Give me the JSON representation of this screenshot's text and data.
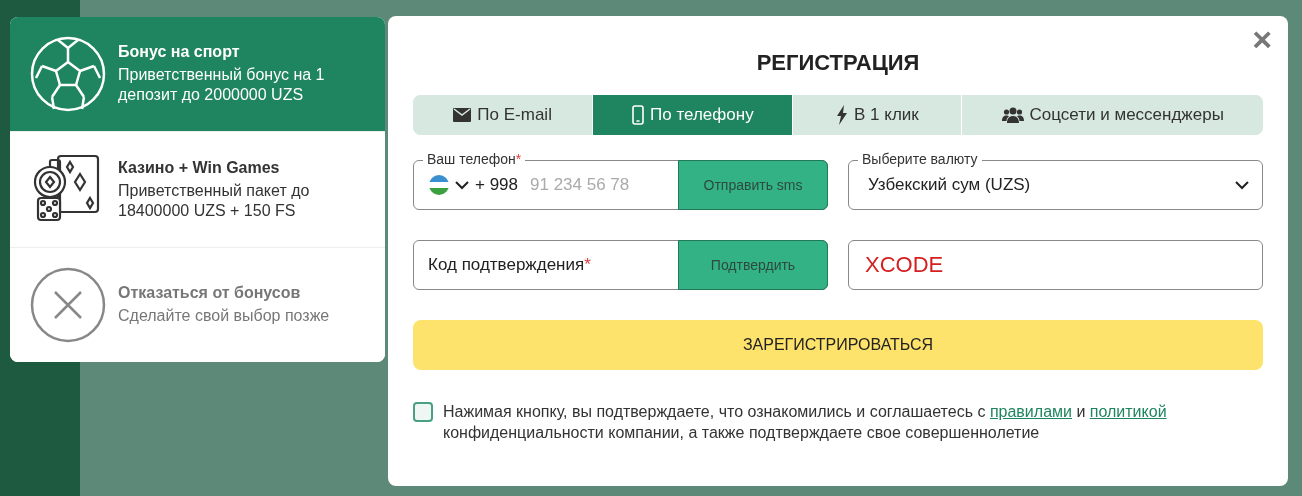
{
  "bonuses": [
    {
      "kind": "sport",
      "title": "Бонус на спорт",
      "description": "Приветственный бонус на 1 депозит до 2000000 UZS",
      "selected": true
    },
    {
      "kind": "casino",
      "title": "Казино + Win Games",
      "description": "Приветственный пакет до 18400000 UZS + 150 FS",
      "selected": false
    },
    {
      "kind": "decline",
      "title": "Отказаться от бонусов",
      "description": "Сделайте свой выбор позже",
      "selected": false
    }
  ],
  "dialog": {
    "close": "×",
    "title": "РЕГИСТРАЦИЯ",
    "tabs": [
      {
        "kind": "email",
        "label": "По E-mail",
        "selected": false
      },
      {
        "kind": "phone",
        "label": "По телефону",
        "selected": true
      },
      {
        "kind": "bolt",
        "label": "В 1 клик",
        "selected": false
      },
      {
        "kind": "people",
        "label": "Соцсети и мессенджеры",
        "selected": false
      }
    ],
    "phone": {
      "label": "Ваш телефон",
      "required": "*",
      "prefix": "+ 998",
      "placeholder": "91 234 56 78",
      "button": "Отправить sms"
    },
    "currency": {
      "label": "Выберите валюту",
      "value": "Узбекский сум (UZS)"
    },
    "code": {
      "placeholder": "Код подтверждения",
      "required": "*",
      "button": "Подтвердить"
    },
    "promo": {
      "value": "XCODE"
    },
    "submit": "ЗАРЕГИСТРИРОВАТЬСЯ",
    "consent": {
      "checked": false,
      "before": "Нажимая кнопку, вы подтверждаете, что ознакомились и соглашаетесь с ",
      "link_1": "правилами",
      "middle": " и ",
      "link_2": "политикой",
      "after": " конфиденциальности компании, а также подтверждаете свое совершеннолетие"
    }
  }
}
